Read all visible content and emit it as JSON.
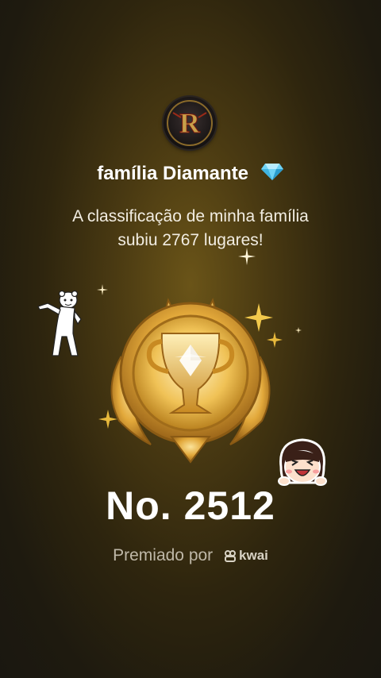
{
  "family": {
    "name": "família Diamante",
    "gem_icon": "diamond-icon"
  },
  "message": {
    "line1": "A classificação de minha família",
    "line2": "subiu 2767 lugares!"
  },
  "rank": {
    "label": "No. 2512"
  },
  "award": {
    "prefix": "Premiado por",
    "brand": "kwai"
  },
  "colors": {
    "gold": "#f2c94c",
    "gold_dark": "#a9741a",
    "gem": "#6fd3f5"
  }
}
